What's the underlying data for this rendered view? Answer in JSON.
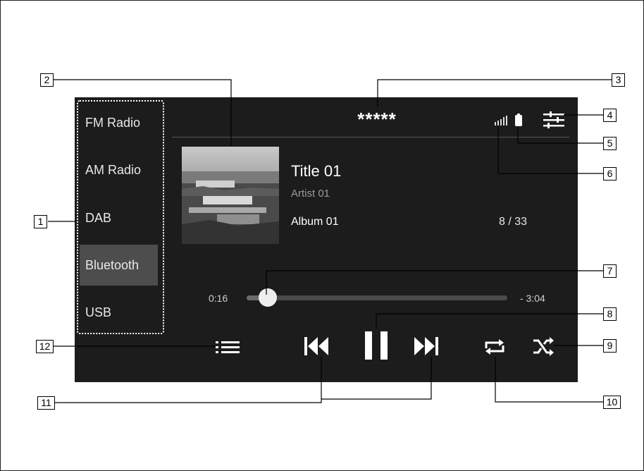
{
  "sources": [
    {
      "label": "FM Radio",
      "active": false
    },
    {
      "label": "AM Radio",
      "active": false
    },
    {
      "label": "DAB",
      "active": false
    },
    {
      "label": "Bluetooth",
      "active": true
    },
    {
      "label": "USB",
      "active": false
    }
  ],
  "header": {
    "device_name": "*****"
  },
  "track": {
    "title": "Title 01",
    "artist": "Artist 01",
    "album": "Album 01",
    "position": "8 / 33"
  },
  "progress": {
    "elapsed": "0:16",
    "remaining": "- 3:04",
    "fraction": 0.08
  },
  "icons": {
    "settings": "equalizer-settings-icon",
    "bluetooth_battery": "battery-icon",
    "signal": "signal-strength-icon",
    "list": "list-icon",
    "previous": "skip-previous-icon",
    "pause": "pause-icon",
    "next": "skip-next-icon",
    "repeat": "repeat-icon",
    "shuffle": "shuffle-icon"
  },
  "callouts": [
    "1",
    "2",
    "3",
    "4",
    "5",
    "6",
    "7",
    "8",
    "9",
    "10",
    "11",
    "12"
  ],
  "colors": {
    "screen_bg": "#1c1c1c",
    "active_source_bg": "#4d4d4d",
    "text": "#ffffff",
    "muted": "#9a9a9a"
  }
}
